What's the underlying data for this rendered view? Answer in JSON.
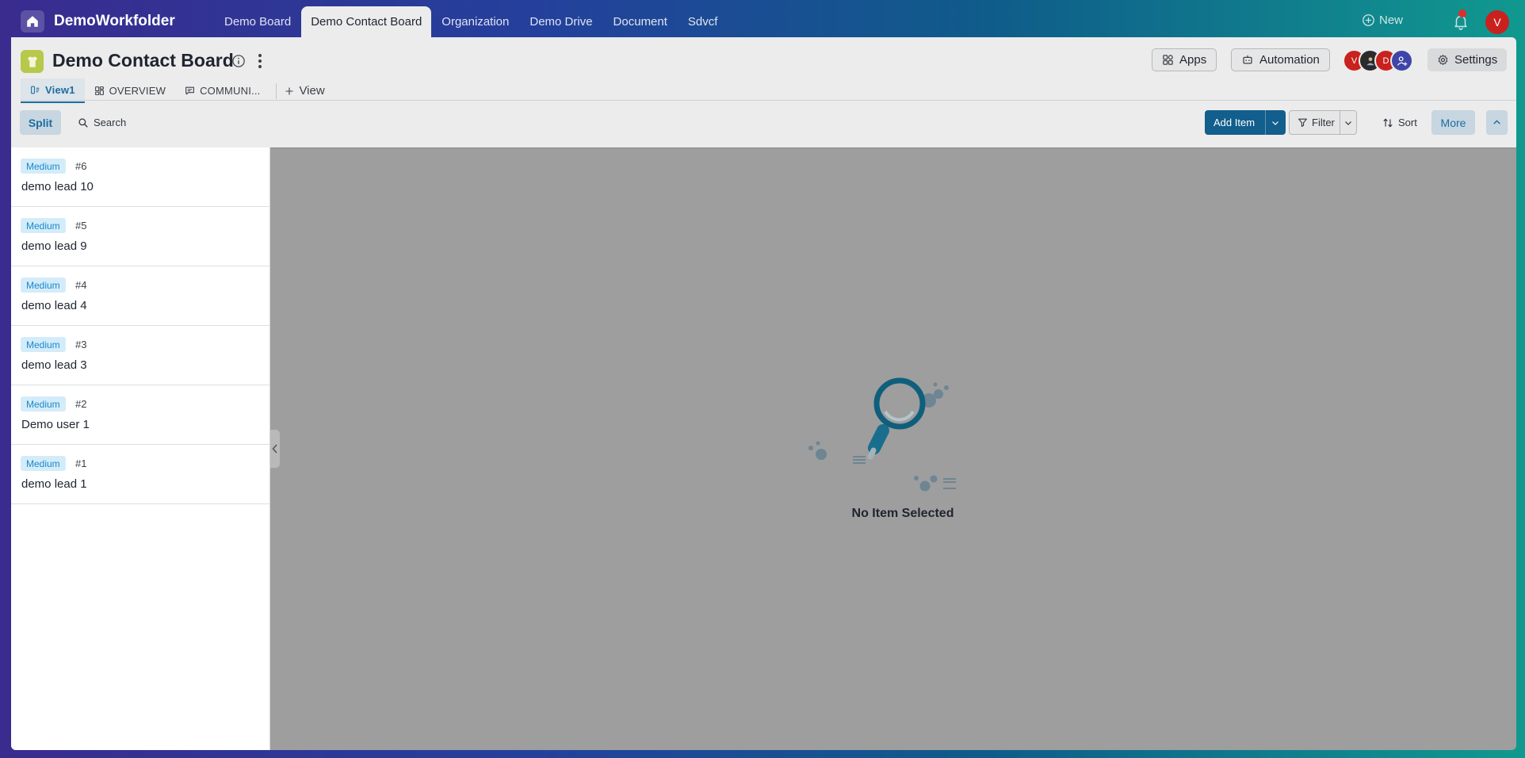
{
  "app": {
    "brand": "DemoWorkfolder",
    "nav_tabs": [
      "Demo Board",
      "Demo Contact Board",
      "Organization",
      "Demo Drive",
      "Document",
      "Sdvcf"
    ],
    "active_tab": "Demo Contact Board",
    "new_label": "New",
    "user_initial": "V"
  },
  "board": {
    "title": "Demo Contact Board",
    "apps_label": "Apps",
    "automation_label": "Automation",
    "settings_label": "Settings",
    "members": [
      {
        "initial": "V",
        "color": "#c9211e"
      },
      {
        "initial": "",
        "color": "#2b2b2b"
      },
      {
        "initial": "D",
        "color": "#c9211e"
      },
      {
        "initial": "",
        "color": "#3d45a8"
      }
    ]
  },
  "views": {
    "tabs": [
      "View1",
      "OVERVIEW",
      "COMMUNI..."
    ],
    "add_view_label": "View"
  },
  "toolbar": {
    "split_label": "Split",
    "search_label": "Search",
    "add_item_label": "Add Item",
    "filter_label": "Filter",
    "sort_label": "Sort",
    "more_label": "More"
  },
  "items": [
    {
      "priority": "Medium",
      "number": "#6",
      "name": "demo lead 10"
    },
    {
      "priority": "Medium",
      "number": "#5",
      "name": "demo lead 9"
    },
    {
      "priority": "Medium",
      "number": "#4",
      "name": "demo lead 4"
    },
    {
      "priority": "Medium",
      "number": "#3",
      "name": "demo lead 3"
    },
    {
      "priority": "Medium",
      "number": "#2",
      "name": "Demo user 1"
    },
    {
      "priority": "Medium",
      "number": "#1",
      "name": "demo lead 1"
    }
  ],
  "empty_state": {
    "message": "No Item Selected"
  },
  "colors": {
    "accent": "#125e8c",
    "badge_bg": "#d4ecfa",
    "badge_text": "#1989c9",
    "notification": "#e52b2b"
  }
}
